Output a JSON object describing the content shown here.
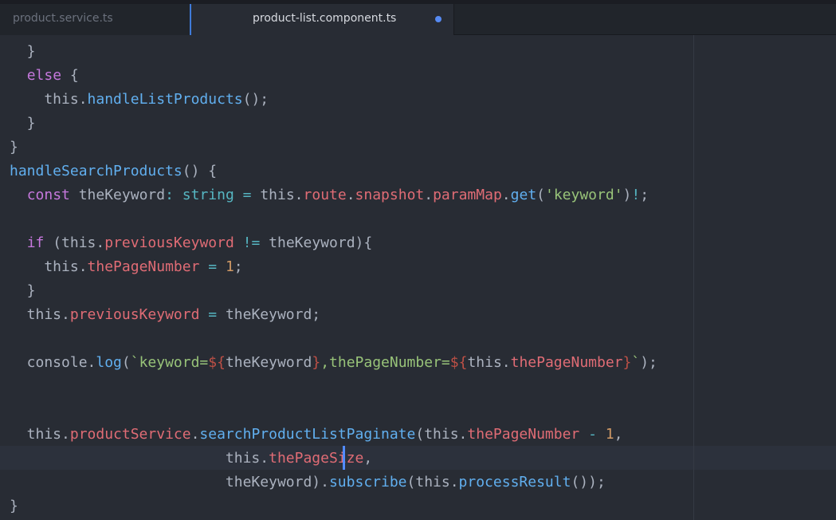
{
  "tabs": [
    {
      "label": "product.service.ts",
      "active": false,
      "modified": false
    },
    {
      "label": "product-list.component.ts",
      "active": true,
      "modified": true
    }
  ],
  "colors": {
    "background": "#282c34",
    "tab_bar": "#21252b",
    "accent": "#528bff",
    "keyword": "#c678dd",
    "function": "#61afef",
    "property": "#e06c75",
    "type": "#56b6c2",
    "string": "#98c379",
    "number": "#d19a66",
    "plain": "#abb2bf"
  },
  "code_lines": [
    [
      {
        "t": "  }",
        "c": "p"
      }
    ],
    [
      {
        "t": "  ",
        "c": "p"
      },
      {
        "t": "else",
        "c": "kw"
      },
      {
        "t": " {",
        "c": "p"
      }
    ],
    [
      {
        "t": "    this.",
        "c": "p"
      },
      {
        "t": "handleListProducts",
        "c": "fn"
      },
      {
        "t": "();",
        "c": "p"
      }
    ],
    [
      {
        "t": "  }",
        "c": "p"
      }
    ],
    [
      {
        "t": "}",
        "c": "p"
      }
    ],
    [
      {
        "t": "handleSearchProducts",
        "c": "fn"
      },
      {
        "t": "() {",
        "c": "p"
      }
    ],
    [
      {
        "t": "  ",
        "c": "p"
      },
      {
        "t": "const",
        "c": "kw"
      },
      {
        "t": " theKeyword",
        "c": "p"
      },
      {
        "t": ": ",
        "c": "op"
      },
      {
        "t": "string",
        "c": "ty"
      },
      {
        "t": " = ",
        "c": "op"
      },
      {
        "t": "this.",
        "c": "p"
      },
      {
        "t": "route",
        "c": "prop"
      },
      {
        "t": ".",
        "c": "p"
      },
      {
        "t": "snapshot",
        "c": "prop"
      },
      {
        "t": ".",
        "c": "p"
      },
      {
        "t": "paramMap",
        "c": "prop"
      },
      {
        "t": ".",
        "c": "p"
      },
      {
        "t": "get",
        "c": "fn"
      },
      {
        "t": "(",
        "c": "p"
      },
      {
        "t": "'keyword'",
        "c": "str"
      },
      {
        "t": ")",
        "c": "p"
      },
      {
        "t": "!",
        "c": "op"
      },
      {
        "t": ";",
        "c": "p"
      }
    ],
    [],
    [
      {
        "t": "  ",
        "c": "p"
      },
      {
        "t": "if",
        "c": "kw"
      },
      {
        "t": " (this.",
        "c": "p"
      },
      {
        "t": "previousKeyword",
        "c": "prop"
      },
      {
        "t": " != ",
        "c": "op"
      },
      {
        "t": "theKeyword){",
        "c": "p"
      }
    ],
    [
      {
        "t": "    this.",
        "c": "p"
      },
      {
        "t": "thePageNumber",
        "c": "prop"
      },
      {
        "t": " = ",
        "c": "op"
      },
      {
        "t": "1",
        "c": "num"
      },
      {
        "t": ";",
        "c": "p"
      }
    ],
    [
      {
        "t": "  }",
        "c": "p"
      }
    ],
    [
      {
        "t": "  this.",
        "c": "p"
      },
      {
        "t": "previousKeyword",
        "c": "prop"
      },
      {
        "t": " = ",
        "c": "op"
      },
      {
        "t": "theKeyword;",
        "c": "p"
      }
    ],
    [],
    [
      {
        "t": "  console.",
        "c": "p"
      },
      {
        "t": "log",
        "c": "fn"
      },
      {
        "t": "(",
        "c": "p"
      },
      {
        "t": "`keyword=",
        "c": "str"
      },
      {
        "t": "${",
        "c": "tpl"
      },
      {
        "t": "theKeyword",
        "c": "p"
      },
      {
        "t": "}",
        "c": "tpl"
      },
      {
        "t": ",thePageNumber=",
        "c": "str"
      },
      {
        "t": "${",
        "c": "tpl"
      },
      {
        "t": "this.",
        "c": "p"
      },
      {
        "t": "thePageNumber",
        "c": "prop"
      },
      {
        "t": "}",
        "c": "tpl"
      },
      {
        "t": "`",
        "c": "str"
      },
      {
        "t": ");",
        "c": "p"
      }
    ],
    [],
    [],
    [
      {
        "t": "  this.",
        "c": "p"
      },
      {
        "t": "productService",
        "c": "prop"
      },
      {
        "t": ".",
        "c": "p"
      },
      {
        "t": "searchProductListPaginate",
        "c": "fn"
      },
      {
        "t": "(this.",
        "c": "p"
      },
      {
        "t": "thePageNumber",
        "c": "prop"
      },
      {
        "t": " - ",
        "c": "op"
      },
      {
        "t": "1",
        "c": "num"
      },
      {
        "t": ",",
        "c": "p"
      }
    ],
    [
      {
        "t": "                         this.",
        "c": "p"
      },
      {
        "t": "thePageSize",
        "c": "prop"
      },
      {
        "t": ",",
        "c": "p"
      }
    ],
    [
      {
        "t": "                         theKeyword).",
        "c": "p"
      },
      {
        "t": "subscribe",
        "c": "fn"
      },
      {
        "t": "(this.",
        "c": "p"
      },
      {
        "t": "processResult",
        "c": "fn"
      },
      {
        "t": "());",
        "c": "p"
      }
    ],
    [
      {
        "t": "}",
        "c": "p"
      }
    ]
  ]
}
